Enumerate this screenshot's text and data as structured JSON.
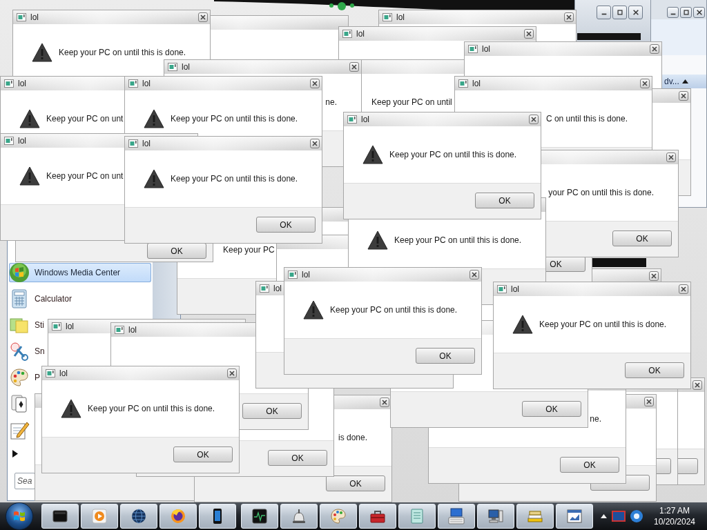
{
  "background_window": {
    "section_header": "dv..."
  },
  "start_menu": {
    "programs": [
      {
        "label": "Windows Media Center",
        "selected": true
      },
      {
        "label": "Calculator",
        "selected": false
      },
      {
        "label": "Sti",
        "selected": false
      },
      {
        "label": "Sn",
        "selected": false
      },
      {
        "label": "P",
        "selected": false
      },
      {
        "selected": false
      },
      {
        "selected": false
      }
    ],
    "search": {
      "placeholder": "Sea"
    }
  },
  "dialogs": [
    {
      "title": "lol",
      "message": "Keep your PC on until this is done."
    },
    {
      "title": "lol"
    },
    {
      "title": "lol"
    },
    {
      "title": "lol"
    },
    {
      "title": "lol",
      "message": "Keep your PC on unt"
    },
    {
      "title": "lol",
      "message": "ne."
    },
    {
      "title": "lol",
      "message": "Keep your PC on until this is done."
    },
    {
      "message": "Keep your PC on until"
    },
    {
      "title": "lol",
      "message": "C on until this is done."
    },
    {
      "title": "lol",
      "message": "Keep your PC on unt"
    },
    {
      "title": "lol",
      "message": "Keep your PC on until this is done.",
      "button": "OK"
    },
    {
      "title": "lol",
      "message": "Keep your PC on until this is done.",
      "button": "OK"
    },
    {
      "button": "OK"
    },
    {
      "message": "Keep your PC"
    },
    {
      "message": "Keep your PC on until this is done."
    },
    {
      "message": "your PC on until this is done.",
      "button": "OK"
    },
    {
      "title": "lol"
    },
    {
      "title": "lol"
    },
    {
      "title": "lol",
      "button": "OK"
    },
    {
      "title": "lol",
      "message": "Keep your PC on until this is done.",
      "button": "OK"
    },
    {
      "button": "OK"
    },
    {
      "title": "lol",
      "message": "Keep your PC on until this is done.",
      "button": "OK"
    },
    {
      "title": "lol",
      "message": "Keep your PC on until this is done.",
      "button": "OK"
    },
    {
      "button": "OK"
    },
    {
      "button": "OK"
    },
    {
      "message": "is done.",
      "button": "OK"
    },
    {
      "message": "ne.",
      "button": "OK"
    }
  ],
  "taskbar": {
    "apps": [
      {
        "running": true
      },
      {
        "running": true
      },
      {
        "running": true
      },
      {
        "running": true
      },
      {
        "running": true
      },
      {
        "running": true
      },
      {
        "running": true
      },
      {
        "running": true
      },
      {
        "running": true
      },
      {
        "running": true
      },
      {
        "running": true
      },
      {
        "running": true
      },
      {
        "running": true
      },
      {
        "running": true
      }
    ],
    "clock": {
      "time": "1:27 AM",
      "date": "10/20/2024"
    }
  }
}
